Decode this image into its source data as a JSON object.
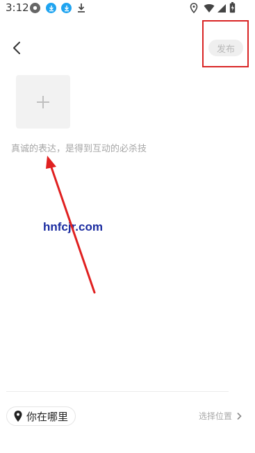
{
  "status_bar": {
    "time": "3:12",
    "notif_icons": [
      "app-icon",
      "download-icon",
      "download-icon",
      "download-icon"
    ],
    "right_icons": [
      "location-icon",
      "wifi-icon",
      "signal-icon",
      "battery-icon"
    ]
  },
  "header": {
    "back_icon": "chevron-left-icon",
    "publish_label": "发布"
  },
  "editor": {
    "add_icon": "plus-icon",
    "placeholder": "真诚的表达，是得到互动的必杀技"
  },
  "watermark": "hnfcjr.com",
  "footer": {
    "location_chip_label": "你在哪里",
    "choose_location_label": "选择位置"
  },
  "annotation": {
    "highlight_color": "#d92424",
    "arrow_color": "#e02020"
  }
}
